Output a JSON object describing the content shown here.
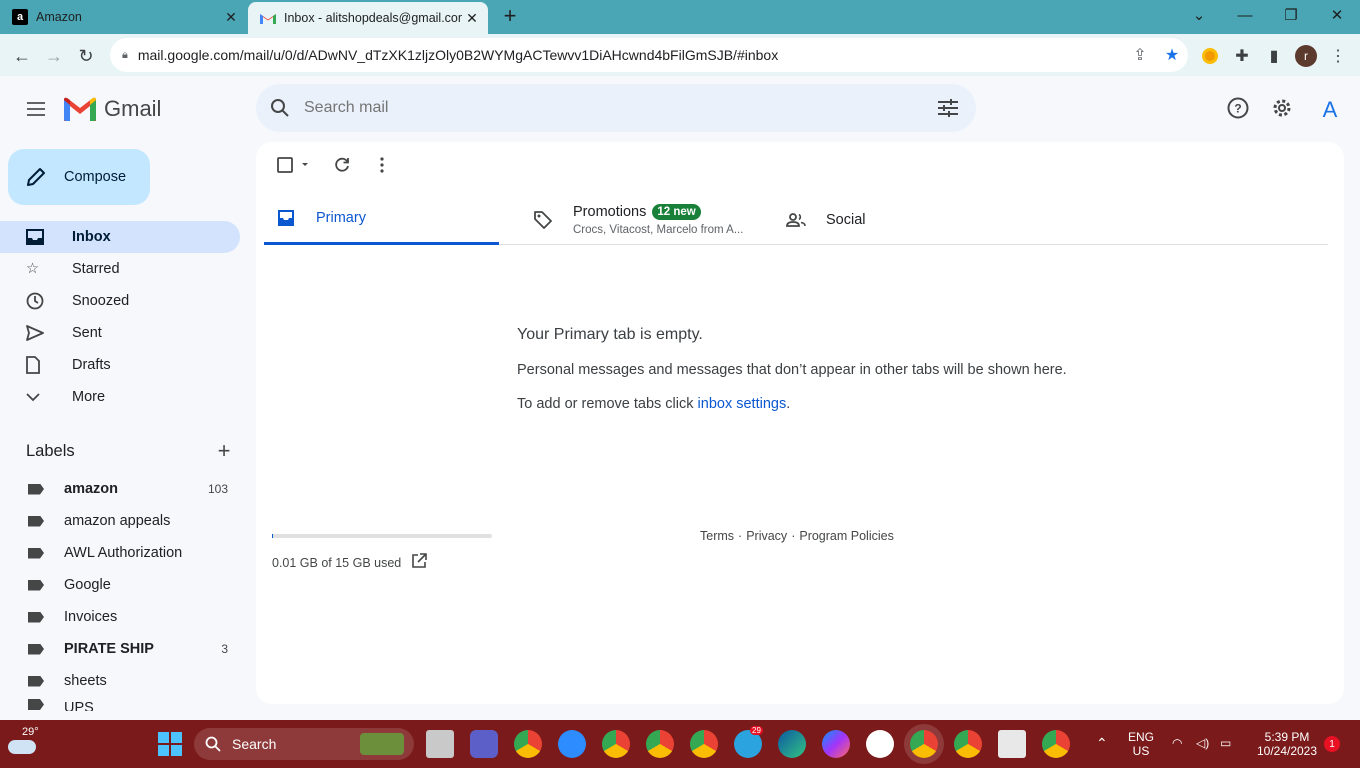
{
  "browser": {
    "tabs": [
      {
        "title": "Amazon",
        "favicon": "amazon-icon"
      },
      {
        "title": "Inbox - alitshopdeals@gmail.com",
        "favicon": "gmail-icon"
      }
    ],
    "url": "mail.google.com/mail/u/0/d/ADwNV_dTzXK1zljzOly0B2WYMgACTewvv1DiAHcwnd4bFilGmSJB/#inbox",
    "profile_initial": "r"
  },
  "gmail": {
    "wordmark": "Gmail",
    "search_placeholder": "Search mail",
    "avatar_initial": "A",
    "compose_label": "Compose",
    "nav": [
      {
        "label": "Inbox",
        "icon": "inbox-icon"
      },
      {
        "label": "Starred",
        "icon": "star-icon"
      },
      {
        "label": "Snoozed",
        "icon": "clock-icon"
      },
      {
        "label": "Sent",
        "icon": "send-icon"
      },
      {
        "label": "Drafts",
        "icon": "draft-icon"
      },
      {
        "label": "More",
        "icon": "chevron-down-icon"
      }
    ],
    "labels_title": "Labels",
    "labels": [
      {
        "name": "amazon",
        "count": "103",
        "bold": true
      },
      {
        "name": "amazon appeals",
        "count": ""
      },
      {
        "name": "AWL Authorization",
        "count": ""
      },
      {
        "name": "Google",
        "count": ""
      },
      {
        "name": "Invoices",
        "count": ""
      },
      {
        "name": "PIRATE SHIP",
        "count": "3",
        "bold": true
      },
      {
        "name": "sheets",
        "count": ""
      },
      {
        "name": "UPS",
        "count": ""
      }
    ],
    "tabs": {
      "primary": "Primary",
      "promotions": "Promotions",
      "promotions_badge": "12 new",
      "promotions_senders": "Crocs, Vitacost, Marcelo from A...",
      "social": "Social"
    },
    "empty": {
      "heading": "Your Primary tab is empty.",
      "line1": "Personal messages and messages that don’t appear in other tabs will be shown here.",
      "line2_prefix": "To add or remove tabs click ",
      "line2_link": "inbox settings",
      "line2_suffix": "."
    },
    "storage": {
      "text": "0.01 GB of 15 GB used",
      "fraction": 0.0007
    },
    "footer": {
      "terms": "Terms",
      "privacy": "Privacy",
      "policies": "Program Policies",
      "sep": "·"
    }
  },
  "taskbar": {
    "weather": "29°",
    "search": "Search",
    "lang_top": "ENG",
    "lang_bottom": "US",
    "time": "5:39 PM",
    "date": "10/24/2023",
    "notifications": "1",
    "telegram_badge": "29"
  },
  "colors": {
    "tabstrip": "#4aa6b5",
    "accent": "#0b57d0",
    "taskbar": "#7a1a1a"
  }
}
